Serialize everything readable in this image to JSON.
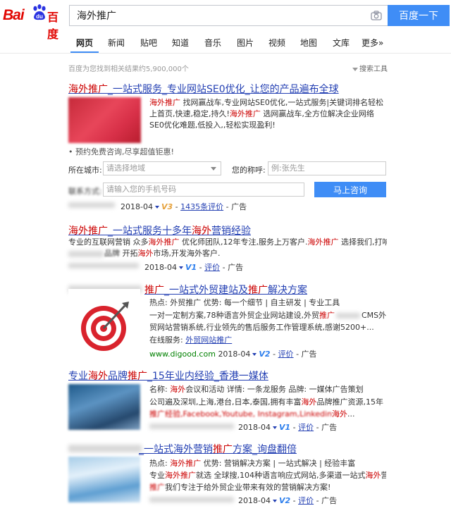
{
  "header": {
    "logo_left": "Bai",
    "logo_right": "百度",
    "search_value": "海外推广",
    "search_button": "百度一下"
  },
  "tabs": [
    "网页",
    "新闻",
    "贴吧",
    "知道",
    "音乐",
    "图片",
    "视频",
    "地图",
    "文库",
    "更多»"
  ],
  "stats": {
    "result_count": "百度为您找到相关结果约5,900,000个",
    "tools_label": "搜索工具"
  },
  "results": [
    {
      "title_a": "海外推广",
      "title_b": "_一站式服务_专业网站SE0优化_让您的产品遍布全球",
      "desc_a1": "海外推广",
      "desc_a2": " 找网赢战车,专业网站SE0优化,一站式服务|关键词排名轻松上首页,快速,稳定,持久!",
      "desc_a3": "海外推广",
      "desc_a4": " 选网赢战车,全方位解决企业网络SE0优化难题,低投入,,轻松实现盈利!",
      "promo": "• 预约免费咨询,尽享超值钜惠!",
      "form": {
        "city_label": "所在城市:",
        "city_placeholder": "请选择地域",
        "name_label": "您的称呼:",
        "name_placeholder": "例:张先生",
        "phone_label": "联系方式:",
        "phone_placeholder": "请输入您的手机号码",
        "submit": "马上咨询"
      },
      "meta_date": "2018-04",
      "meta_v": "V3",
      "meta_reviews": "1435条评价",
      "meta_ad": "- 广告"
    },
    {
      "title_a": "海外推广",
      "title_b": "_一站式服务十多年",
      "title_c": "海外",
      "title_d": "营销经验",
      "desc_1": "专业的互联网营销 众多",
      "desc_2": "海外推广",
      "desc_3": " 优化师团队,12年专注,服务上万客户.",
      "desc_4": "海外推广",
      "desc_5": " 选择我们,打响品牌",
      "desc_6": "海外",
      "desc_7": "市场,开发海外客户.",
      "desc_line2a": "品牌",
      "desc_line2b": " 开拓",
      "meta_date": "2018-04",
      "meta_v": "V1",
      "meta_reviews": "评价",
      "meta_ad": "- 广告"
    },
    {
      "title_a": "推广",
      "title_b": "_一站式外贸建站及",
      "title_c": "推广",
      "title_d": "解决方案",
      "line1": "热点: 外贸推广    优势: 每一个细节 | 自主研发 | 专业工具",
      "line2a": "一对一定制方案,78种语言外贸企业网站建设,外贸",
      "line2b": "推广",
      "line2c": "CMS外",
      "line3": "贸网站营销系统,行业领先的售后服务工作管理系统,感谢5200+...",
      "online_label": "在线服务:",
      "online_link": "外贸网站推广",
      "meta_url": "www.digood.com",
      "meta_date": "2018-04",
      "meta_v": "V2",
      "meta_reviews": "评价",
      "meta_ad": "- 广告"
    },
    {
      "title_a": "专业",
      "title_b": "海外",
      "title_c": "品牌",
      "title_d": "推广",
      "title_e": "_15年业内经验_香港一媒体",
      "line1a": "名称: ",
      "line1b": "海外",
      "line1c": "会议和活动    详情: 一条龙服务    品牌: 一媒体广告策划",
      "line2a": "公司遍及深圳,上海,港台,日本,泰国,拥有丰富",
      "line2b": "海外",
      "line2c": "品牌推广资源,15年",
      "line3a": "推广经验,Facebook,Youtube, Instagram,Linkedin",
      "line3b": "海外",
      "line3c": "...",
      "meta_date": "2018-04",
      "meta_v": "V1",
      "meta_reviews": "评价",
      "meta_ad": "- 广告"
    },
    {
      "title_a": "_一站式海外营销",
      "title_b": "推广",
      "title_c": "方案_询盘翻倍",
      "line1a": "热点: ",
      "line1b": "海外推广",
      "line1c": "    优势: 营销解决方案 | 一站式解决 | 经验丰富",
      "line2a": "专业",
      "line2b": "海外推广",
      "line2c": "就选 全球搜,104种语言响应式网站,多渠道一站式",
      "line2d": "海外",
      "line2e": "营销",
      "line3a": "推广",
      "line3b": "我们专注于给外贸企业带来有效的营销解决方案!",
      "meta_date": "2018-04",
      "meta_v": "V2",
      "meta_reviews": "评价",
      "meta_ad": "- 广告"
    }
  ],
  "colors": {
    "brand_red": "#e10602",
    "accent_blue": "#3f8df6",
    "link": "#2440b3",
    "highlight": "#cc0000",
    "url_green": "#008000"
  }
}
